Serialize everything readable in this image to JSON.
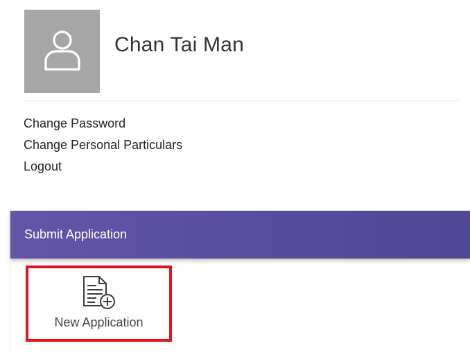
{
  "profile": {
    "name": "Chan Tai Man",
    "avatar_icon": "user-icon"
  },
  "account_links": [
    {
      "label": "Change Password"
    },
    {
      "label": "Change Personal Particulars"
    },
    {
      "label": "Logout"
    }
  ],
  "section": {
    "title": "Submit Application",
    "header_color": "#5a4fa0",
    "tiles": [
      {
        "label": "New Application",
        "icon": "document-add-icon"
      }
    ]
  },
  "highlight_color": "#e2141b"
}
